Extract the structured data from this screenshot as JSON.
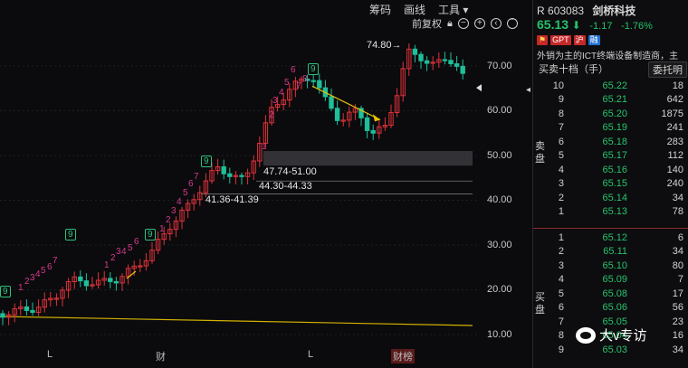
{
  "toolbar": {
    "items": [
      "筹码",
      "画线",
      "工具 ▾"
    ],
    "restore_label": "前复权",
    "lock_icon": "lock-icon",
    "icons": [
      "minus",
      "plus",
      "left",
      "up"
    ]
  },
  "chart": {
    "y_ticks": [
      "70.00",
      "60.00",
      "50.00",
      "40.00",
      "30.00",
      "20.00",
      "10.00"
    ],
    "x_ticks": [
      "L",
      "财",
      "L",
      "财榜"
    ],
    "annotations": {
      "high": "74.80",
      "range1": "47.74-51.00",
      "range2": "44.30-44.33",
      "range3": "41.36-41.39"
    },
    "td_numbers": [
      "1",
      "2",
      "3",
      "4",
      "5",
      "6",
      "7",
      "8",
      "9"
    ]
  },
  "quote": {
    "prefix": "R",
    "code": "603083",
    "name": "剑桥科技",
    "price": "65.13",
    "change": "-1.17",
    "change_pct": "-1.76%",
    "tags": [
      {
        "text": "⚑",
        "bg": "#c62828",
        "fg": "#ffd54f"
      },
      {
        "text": "GPT",
        "bg": "#c62828",
        "fg": "#ffffff"
      },
      {
        "text": "沪",
        "bg": "#c62828",
        "fg": "#ffffff"
      },
      {
        "text": "融",
        "bg": "#1f6fd1",
        "fg": "#ffffff"
      }
    ],
    "description": "外销为主的ICT终端设备制造商，主",
    "orderbook_label": "买卖十档（手）",
    "commission_label": "委托明",
    "sell_label": "卖盘",
    "buy_label": "买盘",
    "asks": [
      {
        "lv": "10",
        "price": "65.22",
        "vol": "18"
      },
      {
        "lv": "9",
        "price": "65.21",
        "vol": "642"
      },
      {
        "lv": "8",
        "price": "65.20",
        "vol": "1875"
      },
      {
        "lv": "7",
        "price": "65.19",
        "vol": "241"
      },
      {
        "lv": "6",
        "price": "65.18",
        "vol": "283"
      },
      {
        "lv": "5",
        "price": "65.17",
        "vol": "112"
      },
      {
        "lv": "4",
        "price": "65.16",
        "vol": "140"
      },
      {
        "lv": "3",
        "price": "65.15",
        "vol": "240"
      },
      {
        "lv": "2",
        "price": "65.14",
        "vol": "34"
      },
      {
        "lv": "1",
        "price": "65.13",
        "vol": "78"
      }
    ],
    "bids": [
      {
        "lv": "1",
        "price": "65.12",
        "vol": "6"
      },
      {
        "lv": "2",
        "price": "65.11",
        "vol": "34"
      },
      {
        "lv": "3",
        "price": "65.10",
        "vol": "80"
      },
      {
        "lv": "4",
        "price": "65.09",
        "vol": "7"
      },
      {
        "lv": "5",
        "price": "65.08",
        "vol": "17"
      },
      {
        "lv": "6",
        "price": "65.06",
        "vol": "56"
      },
      {
        "lv": "7",
        "price": "65.05",
        "vol": "23"
      },
      {
        "lv": "8",
        "price": "65.04",
        "vol": "16"
      },
      {
        "lv": "9",
        "price": "65.03",
        "vol": "34"
      }
    ]
  },
  "watermark": "大v专访",
  "colors": {
    "up": "#e0323a",
    "down": "#1fbf9a",
    "bid_ask_price": "#26c26c",
    "trend": "#e6c200",
    "td_pink": "#d6388d",
    "td_green": "#2ec27e"
  }
}
